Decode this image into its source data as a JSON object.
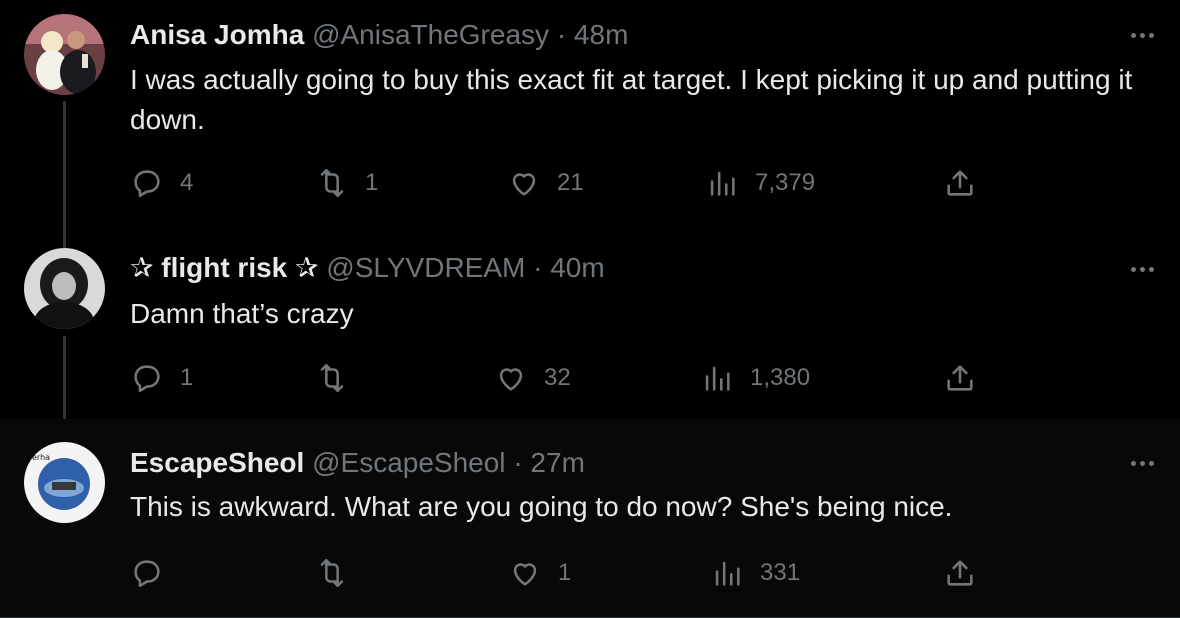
{
  "tweets": [
    {
      "name": "Anisa Jomha",
      "handle": "@AnisaTheGreasy",
      "sep": "·",
      "time": "48m",
      "text": "I was actually going to buy this exact fit at target. I kept picking it up and putting it down.",
      "replies": "4",
      "reposts": "1",
      "likes": "21",
      "views": "7,379"
    },
    {
      "name": "✰ flight risk ✰",
      "handle": "@SLYVDREAM",
      "sep": "·",
      "time": "40m",
      "text": "Damn that’s crazy",
      "replies": "1",
      "reposts": "",
      "likes": "32",
      "views": "1,380"
    },
    {
      "name": "EscapeSheol",
      "handle": "@EscapeSheol",
      "sep": "·",
      "time": "27m",
      "text": "This is awkward. What are you going to do now? She's being nice.",
      "replies": "",
      "reposts": "",
      "likes": "1",
      "views": "331"
    }
  ],
  "colors": {
    "background": "#000000",
    "text": "#e7e9ea",
    "secondary": "#71767b",
    "thread_line": "#333639"
  },
  "icons": [
    "reply-icon",
    "repost-icon",
    "like-icon",
    "views-icon",
    "share-icon",
    "more-icon"
  ]
}
